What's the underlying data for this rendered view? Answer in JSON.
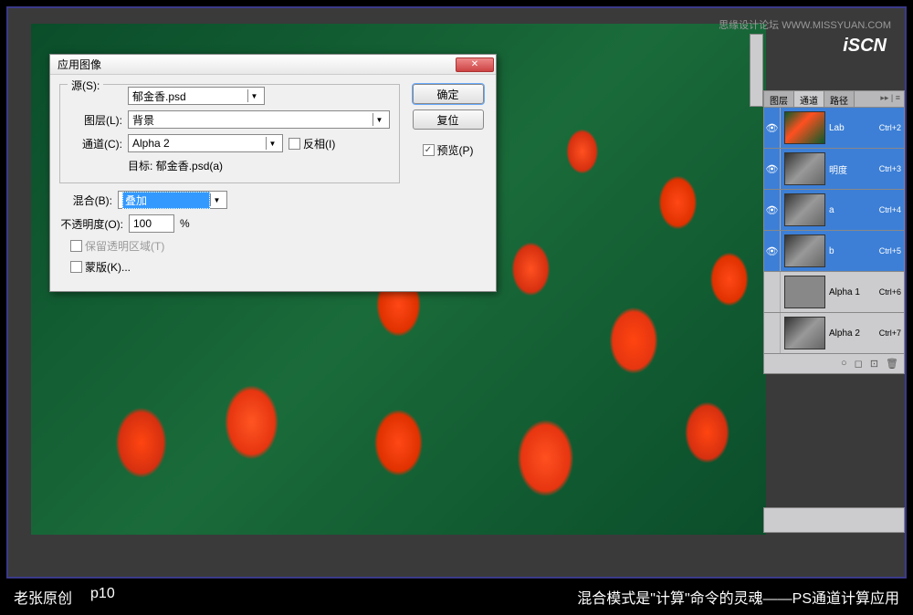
{
  "watermark": {
    "site_text": "思缘设计论坛 WWW.MISSYUAN.COM",
    "logo": "iSCN"
  },
  "dialog": {
    "title": "应用图像",
    "close_symbol": "✕",
    "source_legend": "源(S):",
    "source_value": "郁金香.psd",
    "layer_label": "图层(L):",
    "layer_value": "背景",
    "channel_label": "通道(C):",
    "channel_value": "Alpha 2",
    "invert_label": "反相(I)",
    "target_label": "目标:",
    "target_value": "郁金香.psd(a)",
    "blend_label": "混合(B):",
    "blend_value": "叠加",
    "opacity_label": "不透明度(O):",
    "opacity_value": "100",
    "opacity_unit": "%",
    "preserve_label": "保留透明区域(T)",
    "mask_label": "蒙版(K)...",
    "ok": "确定",
    "reset": "复位",
    "preview": "预览(P)"
  },
  "panel": {
    "tabs": {
      "layers": "图层",
      "channels": "通道",
      "paths": "路径"
    },
    "channels": [
      {
        "name": "Lab",
        "shortcut": "Ctrl+2",
        "selected": true,
        "thumb": "lab",
        "eye": true
      },
      {
        "name": "明度",
        "shortcut": "Ctrl+3",
        "selected": true,
        "thumb": "gray",
        "eye": true
      },
      {
        "name": "a",
        "shortcut": "Ctrl+4",
        "selected": true,
        "thumb": "gray",
        "eye": true
      },
      {
        "name": "b",
        "shortcut": "Ctrl+5",
        "selected": true,
        "thumb": "gray",
        "eye": true
      },
      {
        "name": "Alpha 1",
        "shortcut": "Ctrl+6",
        "selected": false,
        "thumb": "solid",
        "eye": false
      },
      {
        "name": "Alpha 2",
        "shortcut": "Ctrl+7",
        "selected": false,
        "thumb": "gray",
        "eye": false
      }
    ],
    "footer_icons": [
      "○",
      "◻",
      "⊡",
      "🗑"
    ]
  },
  "caption": {
    "author": "老张原创",
    "page": "p10",
    "text": "混合模式是\"计算\"命令的灵魂——PS通道计算应用"
  }
}
